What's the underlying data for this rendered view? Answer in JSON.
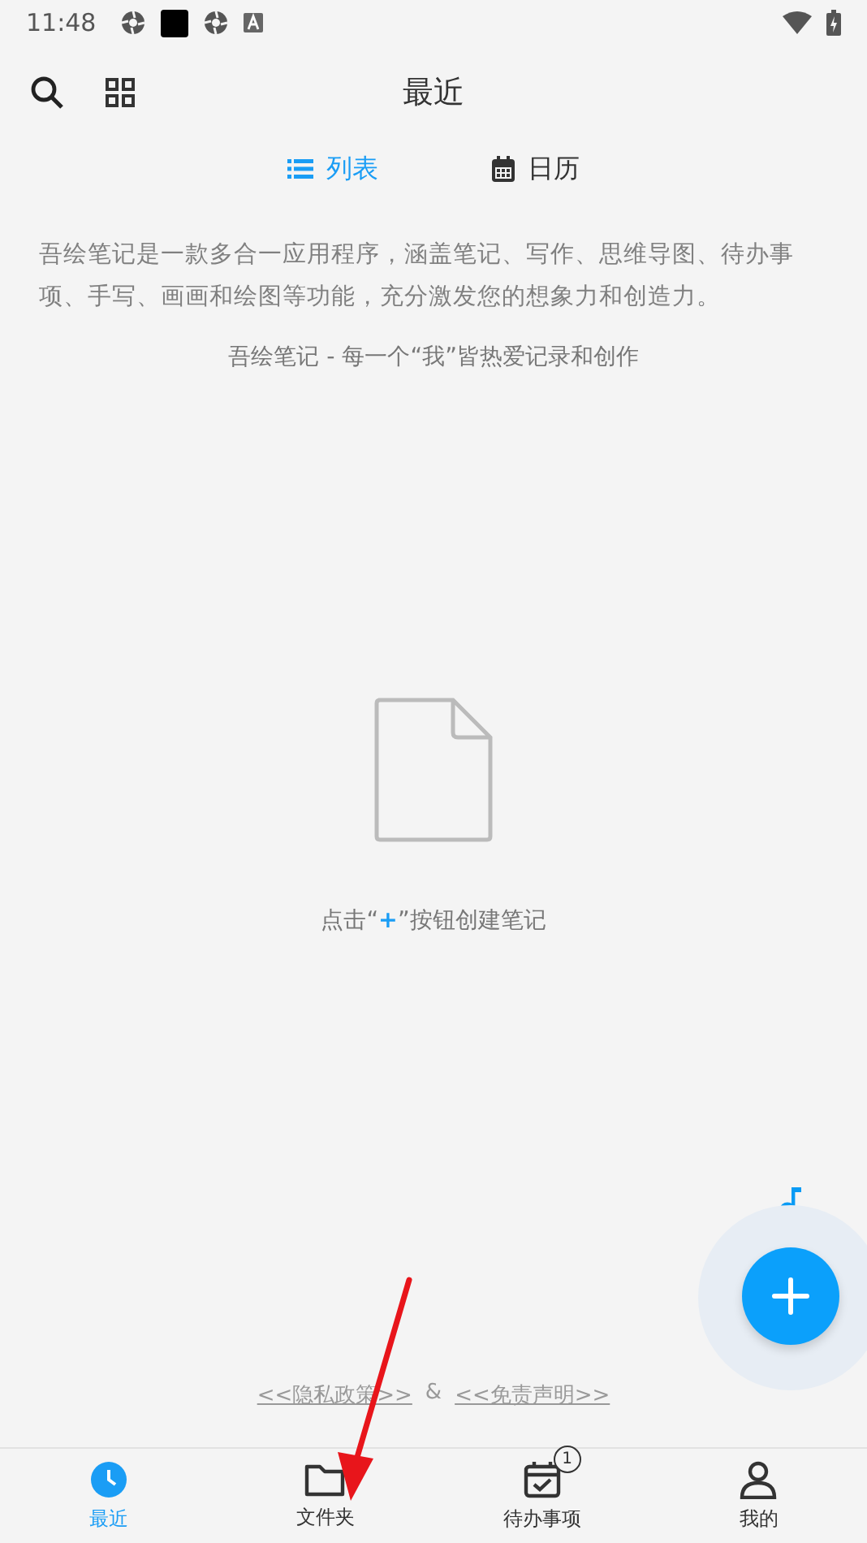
{
  "status_bar": {
    "time": "11:48"
  },
  "header": {
    "title": "最近"
  },
  "view_tabs": [
    {
      "label": "列表",
      "kind": "list",
      "selected": true
    },
    {
      "label": "日历",
      "kind": "calendar",
      "selected": false
    }
  ],
  "description": "吾绘笔记是一款多合一应用程序，涵盖笔记、写作、思维导图、待办事项、手写、画画和绘图等功能，充分激发您的想象力和创造力。",
  "slogan": "吾绘笔记 - 每一个“我”皆热爱记录和创作",
  "empty_hint": {
    "before": "点击“",
    "plus": "+",
    "after": "”按钮创建笔记"
  },
  "links": {
    "privacy": "<<隐私政策>>",
    "separator": "&",
    "disclaimer": "<<免责声明>>"
  },
  "bottom_nav": [
    {
      "label": "最近",
      "kind": "recent",
      "selected": true
    },
    {
      "label": "文件夹",
      "kind": "folder",
      "selected": false
    },
    {
      "label": "待办事项",
      "kind": "todo",
      "selected": false,
      "badge": "1"
    },
    {
      "label": "我的",
      "kind": "profile",
      "selected": false
    }
  ]
}
